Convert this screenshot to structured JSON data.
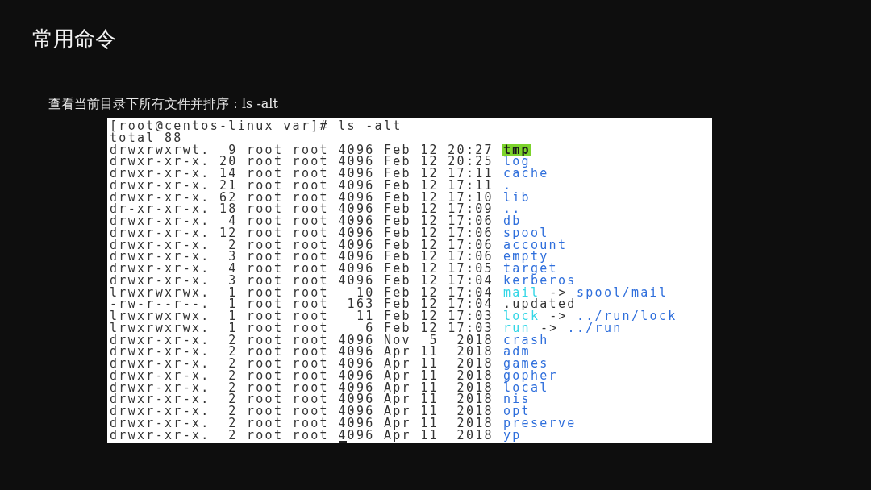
{
  "slide": {
    "title": "常用命令",
    "subtitle": "查看当前目录下所有文件并排序：ls -alt"
  },
  "terminal": {
    "prompt": "[root@centos-linux var]# ls -alt",
    "total": "total 88",
    "rows": [
      {
        "info": "drwxrwxrwt.  9 root root 4096 Feb 12 20:27",
        "name": "tmp",
        "kind": "sticky"
      },
      {
        "info": "drwxr-xr-x. 20 root root 4096 Feb 12 20:25",
        "name": "log",
        "kind": "dir"
      },
      {
        "info": "drwxr-xr-x. 14 root root 4096 Feb 12 17:11",
        "name": "cache",
        "kind": "dir"
      },
      {
        "info": "drwxr-xr-x. 21 root root 4096 Feb 12 17:11",
        "name": ".",
        "kind": "dir"
      },
      {
        "info": "drwxr-xr-x. 62 root root 4096 Feb 12 17:10",
        "name": "lib",
        "kind": "dir"
      },
      {
        "info": "dr-xr-xr-x. 18 root root 4096 Feb 12 17:09",
        "name": "..",
        "kind": "dir"
      },
      {
        "info": "drwxr-xr-x.  4 root root 4096 Feb 12 17:06",
        "name": "db",
        "kind": "dir"
      },
      {
        "info": "drwxr-xr-x. 12 root root 4096 Feb 12 17:06",
        "name": "spool",
        "kind": "dir"
      },
      {
        "info": "drwxr-xr-x.  2 root root 4096 Feb 12 17:06",
        "name": "account",
        "kind": "dir"
      },
      {
        "info": "drwxr-xr-x.  3 root root 4096 Feb 12 17:06",
        "name": "empty",
        "kind": "dir"
      },
      {
        "info": "drwxr-xr-x.  4 root root 4096 Feb 12 17:05",
        "name": "target",
        "kind": "dir"
      },
      {
        "info": "drwxr-xr-x.  3 root root 4096 Feb 12 17:04",
        "name": "kerberos",
        "kind": "dir"
      },
      {
        "info": "lrwxrwxrwx.  1 root root   10 Feb 12 17:04",
        "name": "mail",
        "kind": "link",
        "arrow": "->",
        "target": "spool/mail"
      },
      {
        "info": "-rw-r--r--.  1 root root  163 Feb 12 17:04",
        "name": ".updated",
        "kind": "file"
      },
      {
        "info": "lrwxrwxrwx.  1 root root   11 Feb 12 17:03",
        "name": "lock",
        "kind": "link",
        "arrow": "->",
        "target": "../run/lock"
      },
      {
        "info": "lrwxrwxrwx.  1 root root    6 Feb 12 17:03",
        "name": "run",
        "kind": "link",
        "arrow": "->",
        "target": "../run"
      },
      {
        "info": "drwxr-xr-x.  2 root root 4096 Nov  5  2018",
        "name": "crash",
        "kind": "dir"
      },
      {
        "info": "drwxr-xr-x.  2 root root 4096 Apr 11  2018",
        "name": "adm",
        "kind": "dir"
      },
      {
        "info": "drwxr-xr-x.  2 root root 4096 Apr 11  2018",
        "name": "games",
        "kind": "dir"
      },
      {
        "info": "drwxr-xr-x.  2 root root 4096 Apr 11  2018",
        "name": "gopher",
        "kind": "dir"
      },
      {
        "info": "drwxr-xr-x.  2 root root 4096 Apr 11  2018",
        "name": "local",
        "kind": "dir"
      },
      {
        "info": "drwxr-xr-x.  2 root root 4096 Apr 11  2018",
        "name": "nis",
        "kind": "dir"
      },
      {
        "info": "drwxr-xr-x.  2 root root 4096 Apr 11  2018",
        "name": "opt",
        "kind": "dir"
      },
      {
        "info": "drwxr-xr-x.  2 root root 4096 Apr 11  2018",
        "name": "preserve",
        "kind": "dir"
      },
      {
        "info": "drwxr-xr-x.  2 root root 4096 Apr 11  2018",
        "name": "yp",
        "kind": "dir"
      }
    ]
  }
}
